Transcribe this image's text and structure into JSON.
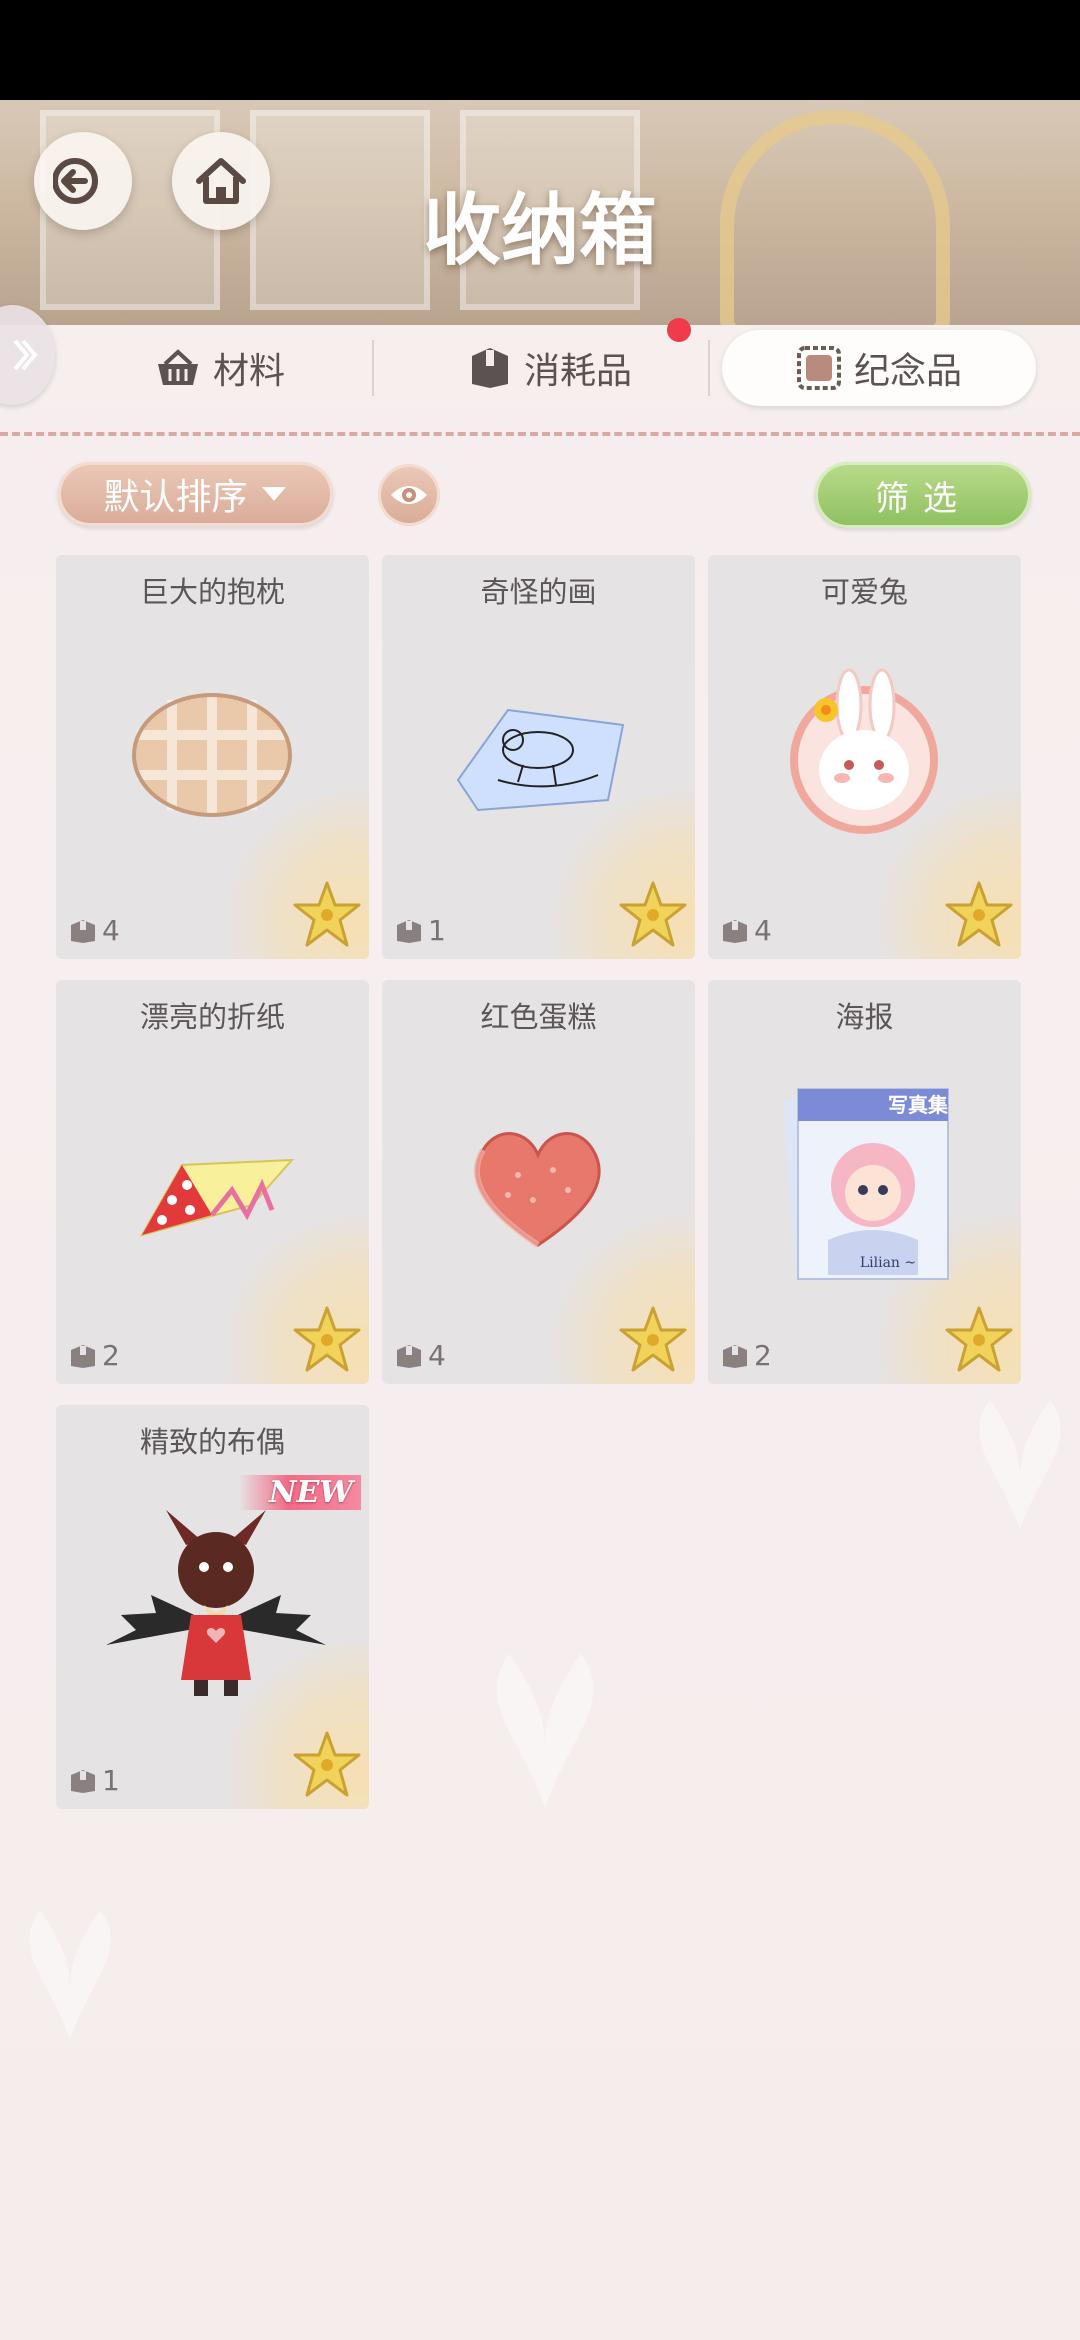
{
  "header": {
    "title": "收纳箱"
  },
  "tabs": [
    {
      "label": "材料",
      "icon": "basket-icon",
      "active": false
    },
    {
      "label": "消耗品",
      "icon": "box-icon",
      "active": false,
      "has_notification": true
    },
    {
      "label": "纪念品",
      "icon": "stamp-icon",
      "active": true
    }
  ],
  "toolbar": {
    "sort_label": "默认排序",
    "filter_label": "筛选"
  },
  "items": [
    {
      "name": "巨大的抱枕",
      "count": "4",
      "art": "pillow"
    },
    {
      "name": "奇怪的画",
      "count": "1",
      "art": "drawing"
    },
    {
      "name": "可爱兔",
      "count": "4",
      "art": "bunny"
    },
    {
      "name": "漂亮的折纸",
      "count": "2",
      "art": "origami"
    },
    {
      "name": "红色蛋糕",
      "count": "4",
      "art": "cake"
    },
    {
      "name": "海报",
      "count": "2",
      "art": "poster",
      "poster_texts": [
        "写真集",
        "Lilian ~"
      ]
    },
    {
      "name": "精致的布偶",
      "count": "1",
      "art": "bat-doll",
      "badge": "NEW"
    }
  ],
  "colors": {
    "accent_sort": "#d9ab98",
    "accent_filter": "#8ebf5f",
    "notification": "#ef3b4b"
  }
}
